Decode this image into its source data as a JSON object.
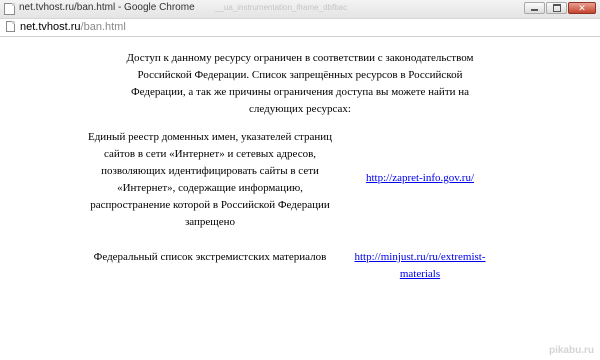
{
  "window": {
    "title": "net.tvhost.ru/ban.html - Google Chrome",
    "title_ghost": "__ua_instrumentation_iframe_dbfbac",
    "minimize_glyph": "",
    "close_glyph": "✕"
  },
  "address_bar": {
    "url_host": "net.tvhost.ru",
    "url_path": "/ban.html"
  },
  "page": {
    "notice": "Доступ к данному ресурсу ограничен в соответствии с законодательством Российской Федерации. Список запрещённых ресурсов в Российской Федерации, а так же причины ограничения доступа вы можете найти на следующих ресурсах:",
    "resources": [
      {
        "description": "Единый реестр доменных имен, указателей страниц сайтов в сети «Интернет» и сетевых адресов, позволяющих идентифицировать сайты в сети «Интернет», содержащие информацию, распространение которой в Российской Федерации запрещено",
        "link": "http://zapret-info.gov.ru/"
      },
      {
        "description": "Федеральный список экстремистских материалов",
        "link": "http://minjust.ru/ru/extremist-materials"
      }
    ]
  },
  "watermark": "pikabu.ru",
  "colors": {
    "link": "#0000ee",
    "close_button": "#c4442e",
    "url_path": "#8a8a8a"
  },
  "icons": {
    "app": "page-icon",
    "address": "page-icon"
  }
}
